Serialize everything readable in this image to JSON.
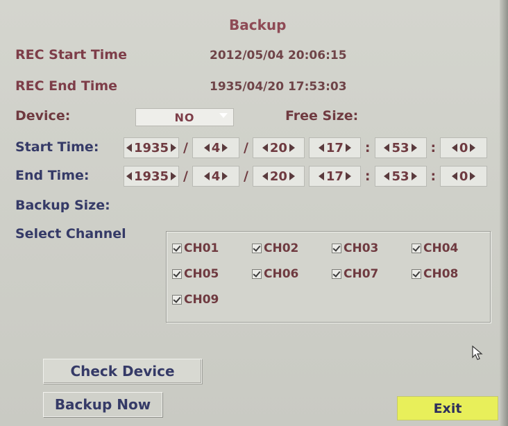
{
  "header": {
    "title": "Backup"
  },
  "rec": {
    "start_label": "REC Start Time",
    "start_value": "2012/05/04 20:06:15",
    "end_label": "REC End Time",
    "end_value": "1935/04/20 17:53:03"
  },
  "device": {
    "label": "Device:",
    "selected": "NO",
    "free_size_label": "Free Size:"
  },
  "start_time": {
    "label": "Start Time:",
    "year": "1935",
    "month": "4",
    "day": "20",
    "hour": "17",
    "minute": "53",
    "second": "0"
  },
  "end_time": {
    "label": "End Time:",
    "year": "1935",
    "month": "4",
    "day": "20",
    "hour": "17",
    "minute": "53",
    "second": "0"
  },
  "separators": {
    "date": "/",
    "time": ":"
  },
  "backup_size": {
    "label": "Backup Size:"
  },
  "channels": {
    "label": "Select Channel",
    "items": [
      {
        "label": "CH01",
        "checked": true
      },
      {
        "label": "CH02",
        "checked": true
      },
      {
        "label": "CH03",
        "checked": true
      },
      {
        "label": "CH04",
        "checked": true
      },
      {
        "label": "CH05",
        "checked": true
      },
      {
        "label": "CH06",
        "checked": true
      },
      {
        "label": "CH07",
        "checked": true
      },
      {
        "label": "CH08",
        "checked": true
      },
      {
        "label": "CH09",
        "checked": true
      }
    ]
  },
  "buttons": {
    "check_device": "Check Device",
    "backup_now": "Backup Now",
    "exit": "Exit"
  },
  "colors": {
    "exit_bg": "#e8ef5a",
    "label_maroon": "#7d3d48",
    "label_blue": "#353a67"
  }
}
